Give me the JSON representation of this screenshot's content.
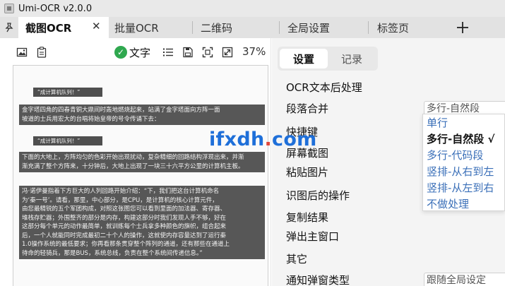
{
  "window": {
    "title": "Umi-OCR v2.0.0"
  },
  "tabs": [
    {
      "label": "截图OCR",
      "active": true,
      "closable": true
    },
    {
      "label": "批量OCR",
      "active": false
    },
    {
      "label": "二维码",
      "active": false
    },
    {
      "label": "全局设置",
      "active": false
    },
    {
      "label": "标签页",
      "active": false
    }
  ],
  "tab_icons": {
    "pin": "pin-icon",
    "close": "close-icon",
    "add": "plus-icon"
  },
  "toolbar": {
    "icons": [
      "image-icon",
      "clipboard-icon",
      "list-icon",
      "save-icon",
      "fit-screen-icon",
      "resize-icon"
    ],
    "status_label": "文字",
    "status_color": "#2fa84f",
    "zoom": "37%"
  },
  "preview": {
    "blocks": [
      {
        "type": "heading",
        "lines": [
          "“成计算机队列！”"
        ]
      },
      {
        "type": "paragraph",
        "lines": [
          "金字塔四角的四春青铜大鼎间时轰地燃烧起来，站满了金字塔面向方阵一面",
          "坡道的士兵用宏大的台唱将始皇帝的号令传诵下去："
        ]
      },
      {
        "type": "heading",
        "lines": [
          "“成计算机队列！”"
        ]
      },
      {
        "type": "paragraph",
        "lines": [
          "下面的大地上，方阵均匀的色彩开始出现扰动，复杂精细的回路结构浮现出来，并渐",
          "渐充满了整个方阵来，十分钟后，大地上出现了一块三十六平方公里的计算机主板。"
        ]
      },
      {
        "type": "paragraph",
        "lines": [
          "冯·诺伊曼指着下方巨大的人列回路开始介绍：“下，我们把这台计算机命名",
          "为‘秦一号’。请看，那里，中心部分，是CPU，是计算机的核心计算元件，",
          "由您最精锐的五个军团构成，对照这张图您可以看到里面的加法器、寄存器、",
          "堆栈存贮器；外围整齐的部分是内存，构建这部分时我们发现人手不够，好在",
          "这部分每个单元的动作最简单，就训练每个士兵拿多种颜色的旗帜，组合起来",
          "后，一个人就能同时完成最初二十个人的操作，这就使内存容量达到了运行秦",
          "1.0操作系统的最低要求；你再看那条贯穿整个阵列的通道，还有那些在通道上",
          "待命的轻骑兵，那是BUS，系统总线，负责在整个系统间传递信息。”"
        ]
      }
    ]
  },
  "right_tabs": [
    {
      "label": "设置",
      "active": true
    },
    {
      "label": "记录",
      "active": false
    }
  ],
  "settings": {
    "ocr_post": {
      "title": "OCR文本后处理",
      "merge_label": "段落合并",
      "merge_value": "多行-自然段",
      "merge_options": [
        "单行",
        "多行-自然段 √",
        "多行-代码段",
        "竖排-从右到左",
        "竖排-从左到右",
        "不做处理"
      ],
      "selected_index": 1
    },
    "hotkeys": {
      "title": "快捷键",
      "items": [
        "屏幕截图",
        "粘贴图片"
      ]
    },
    "after_ocr": {
      "title": "识图后的操作",
      "items": [
        "复制结果",
        "弹出主窗口"
      ]
    },
    "other": {
      "title": "其它",
      "notify_label": "通知弹窗类型",
      "notify_value": "跟随全局设定"
    }
  },
  "watermark": {
    "text_main": "ifxdh",
    "text_dot": ".",
    "text_tail": "com"
  }
}
